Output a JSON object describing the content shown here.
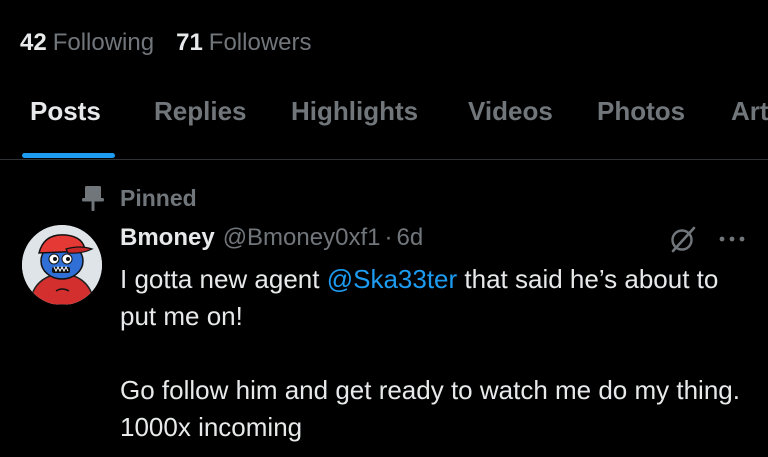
{
  "profile": {
    "following_count": "42",
    "following_label": "Following",
    "followers_count": "71",
    "followers_label": "Followers"
  },
  "tabs": [
    {
      "label": "Posts",
      "active": true
    },
    {
      "label": "Replies",
      "active": false
    },
    {
      "label": "Highlights",
      "active": false
    },
    {
      "label": "Videos",
      "active": false
    },
    {
      "label": "Photos",
      "active": false
    },
    {
      "label": "Art",
      "active": false
    }
  ],
  "post": {
    "pinned_label": "Pinned",
    "author_name": "Bmoney",
    "author_handle": "@Bmoney0xf1",
    "separator": "·",
    "time": "6d",
    "line1_before": "I gotta new agent ",
    "mention": "@Ska33ter",
    "line1_after": " that said he’s about to put me on!",
    "paragraph2": "Go follow him and get ready to watch me do my thing. 1000x incoming"
  },
  "icons": {
    "pin": "pin-icon",
    "grok": "grok-icon",
    "more": "more-horizontal-icon",
    "avatar": "avatar"
  },
  "colors": {
    "background": "#000000",
    "primary_text": "#e7e9ea",
    "secondary_text": "#71767b",
    "accent": "#1d9bf0",
    "divider": "#2f3336"
  }
}
